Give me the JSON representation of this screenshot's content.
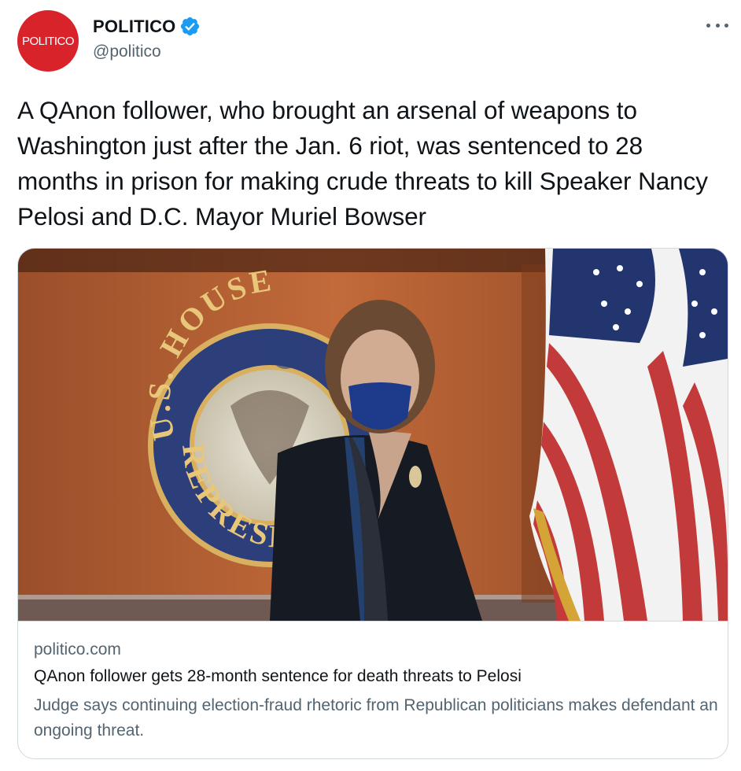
{
  "author": {
    "avatar_text": "POLITICO",
    "display_name": "POLITICO",
    "handle": "@politico",
    "verified": true,
    "avatar_color": "#d8232a",
    "verified_color": "#1d9bf0"
  },
  "tweet": {
    "text": "A QAnon follower, who brought an arsenal of weapons to Washington just after the Jan. 6 riot, was sentenced to 28 months in prison for making crude threats to kill Speaker Nancy Pelosi and D.C. Mayor Muriel Bowser"
  },
  "card": {
    "domain": "politico.com",
    "title": "QAnon follower gets 28-month sentence for death threats to Pelosi",
    "description": "Judge says continuing election-fraud rhetoric from Republican politicians makes defendant an ongoing threat.",
    "image_seal_text": "U.S. HOUSE · REPRESENTATIVES"
  },
  "icons": {
    "verified": "verified-badge-icon",
    "more": "more-options-icon"
  }
}
